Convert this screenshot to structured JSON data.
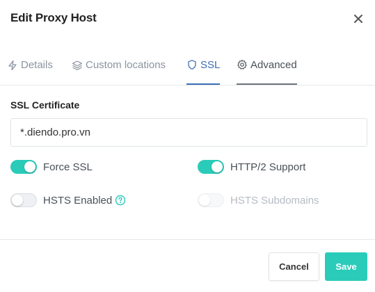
{
  "modal": {
    "title": "Edit Proxy Host"
  },
  "tabs": [
    {
      "label": "Details",
      "icon": "lightning-icon"
    },
    {
      "label": "Custom locations",
      "icon": "layers-icon"
    },
    {
      "label": "SSL",
      "icon": "shield-icon",
      "active": true
    },
    {
      "label": "Advanced",
      "icon": "gear-icon"
    }
  ],
  "ssl": {
    "certificate_label": "SSL Certificate",
    "certificate_value": "*.diendo.pro.vn",
    "toggles": {
      "force_ssl": {
        "label": "Force SSL",
        "on": true
      },
      "http2": {
        "label": "HTTP/2 Support",
        "on": true
      },
      "hsts": {
        "label": "HSTS Enabled",
        "on": false
      },
      "hsts_subdomains": {
        "label": "HSTS Subdomains",
        "on": false,
        "disabled": true
      }
    }
  },
  "footer": {
    "cancel_label": "Cancel",
    "save_label": "Save"
  },
  "colors": {
    "accent": "#2bcbba",
    "active_tab": "#3b6fb6"
  }
}
